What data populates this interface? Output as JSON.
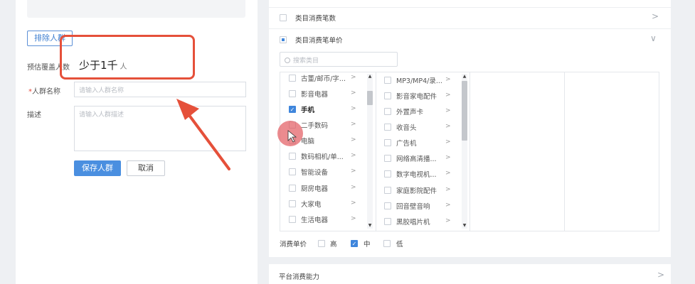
{
  "left": {
    "exclude_button": "排除人群",
    "coverage_label": "预估覆盖人数",
    "coverage_value": "少于1千",
    "coverage_unit": "人",
    "name_label": "人群名称",
    "name_required_mark": "*",
    "name_placeholder": "请输入人群名称",
    "desc_label": "描述",
    "desc_placeholder": "请输入人群描述",
    "save_button": "保存人群",
    "cancel_button": "取消"
  },
  "right": {
    "rows": [
      {
        "label": "类目消费笔数",
        "expanded": false
      },
      {
        "label": "类目消费笔单价",
        "expanded": true
      }
    ],
    "search_placeholder": "搜索类目",
    "col1": [
      {
        "label": "古董/邮币/字...",
        "checked": false
      },
      {
        "label": "影音电器",
        "checked": false
      },
      {
        "label": "手机",
        "checked": true
      },
      {
        "label": "二手数码",
        "checked": false
      },
      {
        "label": "电脑",
        "checked": false
      },
      {
        "label": "数码相机/单...",
        "checked": false
      },
      {
        "label": "智能设备",
        "checked": false
      },
      {
        "label": "厨房电器",
        "checked": false
      },
      {
        "label": "大家电",
        "checked": false
      },
      {
        "label": "生活电器",
        "checked": false
      }
    ],
    "col2": [
      {
        "label": "MP3/MP4/录...",
        "checked": false
      },
      {
        "label": "影音家电配件",
        "checked": false
      },
      {
        "label": "外置声卡",
        "checked": false
      },
      {
        "label": "收音头",
        "checked": false
      },
      {
        "label": "广告机",
        "checked": false
      },
      {
        "label": "网络高清播...",
        "checked": false
      },
      {
        "label": "数字电视机...",
        "checked": false
      },
      {
        "label": "家庭影院配件",
        "checked": false
      },
      {
        "label": "回音壁音响",
        "checked": false
      },
      {
        "label": "黑胶唱片机",
        "checked": false
      }
    ],
    "price_label": "消费单价",
    "price_options": [
      {
        "label": "高",
        "checked": false
      },
      {
        "label": "中",
        "checked": true
      },
      {
        "label": "低",
        "checked": false
      }
    ],
    "bottom_row": "平台消费能力"
  },
  "icons": {
    "gt": ">",
    "chevron_right": ">",
    "chevron_down": "∨",
    "scroll_up": "▲",
    "scroll_down": "▼",
    "check": "✓"
  },
  "colors": {
    "accent": "#4a8fe0",
    "highlight": "#e5503a"
  }
}
